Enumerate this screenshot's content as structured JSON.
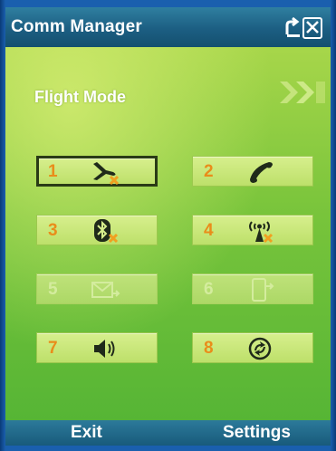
{
  "titlebar": {
    "title": "Comm Manager",
    "icons": [
      "signal-connection-icon",
      "phone-off-icon"
    ]
  },
  "header": {
    "mode_title": "Flight Mode"
  },
  "buttons": [
    {
      "number": "1",
      "icon": "airplane-icon",
      "state": "selected"
    },
    {
      "number": "2",
      "icon": "phone-icon",
      "state": "enabled"
    },
    {
      "number": "3",
      "icon": "bluetooth-icon",
      "state": "enabled"
    },
    {
      "number": "4",
      "icon": "wireless-antenna-icon",
      "state": "enabled"
    },
    {
      "number": "5",
      "icon": "mail-sync-icon",
      "state": "disabled"
    },
    {
      "number": "6",
      "icon": "device-sync-icon",
      "state": "disabled"
    },
    {
      "number": "7",
      "icon": "speaker-icon",
      "state": "enabled"
    },
    {
      "number": "8",
      "icon": "activesync-icon",
      "state": "enabled"
    }
  ],
  "softkeys": {
    "left": "Exit",
    "right": "Settings"
  },
  "colors": {
    "accent_number": "#e98d1a",
    "selected_border": "#2a3b16",
    "status_x": "#f0a020",
    "titlebar": "#1c5e82"
  }
}
